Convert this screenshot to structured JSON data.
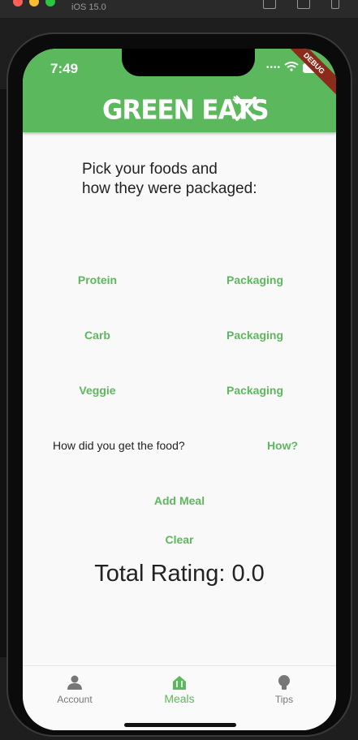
{
  "simulator": {
    "os_version": "iOS 15.0"
  },
  "status_bar": {
    "time": "7:49",
    "debug_banner": "DEBUG"
  },
  "app_bar": {
    "title": "GREEN EATS",
    "logo_icon": "fork-knife-icon",
    "color": "#5cb85c"
  },
  "main": {
    "prompt": "Pick your foods and\nhow they were packaged:",
    "rows": [
      {
        "food": "Protein",
        "packaging": "Packaging"
      },
      {
        "food": "Carb",
        "packaging": "Packaging"
      },
      {
        "food": "Veggie",
        "packaging": "Packaging"
      }
    ],
    "delivery_question": "How did you get the food?",
    "delivery_button": "How?",
    "add_meal": "Add Meal",
    "clear": "Clear",
    "total_rating": "Total Rating: 0.0"
  },
  "bottom_nav": {
    "items": [
      {
        "label": "Account",
        "icon": "person-icon",
        "active": false
      },
      {
        "label": "Meals",
        "icon": "restaurant-icon",
        "active": true
      },
      {
        "label": "Tips",
        "icon": "lightbulb-icon",
        "active": false
      }
    ]
  }
}
